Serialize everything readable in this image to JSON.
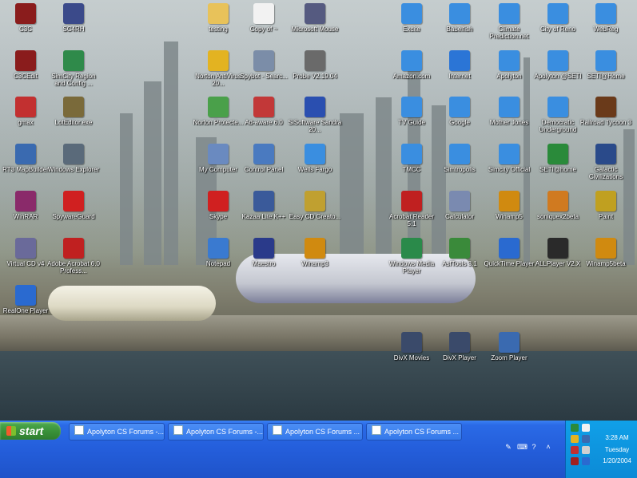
{
  "desktop": {
    "icons": [
      {
        "label": "C3C",
        "icon": "c3c-icon",
        "color": "#8a1c1c"
      },
      {
        "label": "SC4RH",
        "icon": "simcity4-icon",
        "color": "#3b4a8a"
      },
      {
        "label": "testing",
        "icon": "folder-icon",
        "color": "#e8c25a"
      },
      {
        "label": "Copy of ~",
        "icon": "document-icon",
        "color": "#f2f2f2"
      },
      {
        "label": "Microsoft Mouse",
        "icon": "mouse-icon",
        "color": "#555a80"
      },
      {
        "label": "Excite",
        "icon": "internet-shortcut-icon",
        "color": "#3a8ee0"
      },
      {
        "label": "Babelfish",
        "icon": "internet-shortcut-icon",
        "color": "#3a8ee0"
      },
      {
        "label": "Climate Prediction.net",
        "icon": "internet-shortcut-icon",
        "color": "#3a8ee0"
      },
      {
        "label": "City of Reno",
        "icon": "internet-shortcut-icon",
        "color": "#3a8ee0"
      },
      {
        "label": "WebReg",
        "icon": "internet-shortcut-icon",
        "color": "#3a8ee0"
      },
      {
        "label": "C3CEdit",
        "icon": "c3c-edit-icon",
        "color": "#8a1c1c"
      },
      {
        "label": "SimCity Region and Config ...",
        "icon": "simcity-region-icon",
        "color": "#2f8a4a"
      },
      {
        "label": "Norton AntiVirus 20...",
        "icon": "norton-antivirus-icon",
        "color": "#e3b321"
      },
      {
        "label": "Spybot - Searc...",
        "icon": "spybot-icon",
        "color": "#7b8da8"
      },
      {
        "label": "Probe V2.19.04",
        "icon": "probe-icon",
        "color": "#6a6a6a"
      },
      {
        "label": "Amazon.com",
        "icon": "internet-shortcut-icon",
        "color": "#3a8ee0"
      },
      {
        "label": "Internet",
        "icon": "internet-explorer-icon",
        "color": "#2b75d6"
      },
      {
        "label": "Apolyton",
        "icon": "internet-shortcut-icon",
        "color": "#3a8ee0"
      },
      {
        "label": "Apolyton @SETI",
        "icon": "internet-shortcut-icon",
        "color": "#3a8ee0"
      },
      {
        "label": "SETI@Home",
        "icon": "internet-shortcut-icon",
        "color": "#3a8ee0"
      },
      {
        "label": "gmax",
        "icon": "gmax-icon",
        "color": "#c23030"
      },
      {
        "label": "LotEditor.exe",
        "icon": "lot-editor-icon",
        "color": "#7a6a3a"
      },
      {
        "label": "Norton Protecte...",
        "icon": "norton-protected-recycle-bin-icon",
        "color": "#4aa04a"
      },
      {
        "label": "Ad-aware 6.0",
        "icon": "ad-aware-icon",
        "color": "#c23838"
      },
      {
        "label": "SiSoftware Sandra 20...",
        "icon": "sandra-icon",
        "color": "#2a4fb0"
      },
      {
        "label": "TV Guide",
        "icon": "internet-shortcut-icon",
        "color": "#3a8ee0"
      },
      {
        "label": "Google",
        "icon": "internet-shortcut-icon",
        "color": "#3a8ee0"
      },
      {
        "label": "Mother Jones",
        "icon": "internet-shortcut-icon",
        "color": "#3a8ee0"
      },
      {
        "label": "Democratic Underground",
        "icon": "internet-shortcut-icon",
        "color": "#3a8ee0"
      },
      {
        "label": "Railroad Tycoon 3",
        "icon": "railroad-tycoon-icon",
        "color": "#6a3a1a"
      },
      {
        "label": "RT3 MapBuilder",
        "icon": "globe-icon",
        "color": "#3a6ab0"
      },
      {
        "label": "Windows Explorer",
        "icon": "windows-explorer-icon",
        "color": "#5a6a7a"
      },
      {
        "label": "My Computer",
        "icon": "my-computer-icon",
        "color": "#6a8ac0"
      },
      {
        "label": "Control Panel",
        "icon": "control-panel-icon",
        "color": "#4a7ac0"
      },
      {
        "label": "Wells Fargo",
        "icon": "internet-shortcut-icon",
        "color": "#3a8ee0"
      },
      {
        "label": "TMCC",
        "icon": "internet-shortcut-icon",
        "color": "#3a8ee0"
      },
      {
        "label": "Simtropolis",
        "icon": "internet-shortcut-icon",
        "color": "#3a8ee0"
      },
      {
        "label": "Simcity Official",
        "icon": "internet-shortcut-icon",
        "color": "#3a8ee0"
      },
      {
        "label": "SETI@home",
        "icon": "seti-at-home-icon",
        "color": "#2a8a3a"
      },
      {
        "label": "Galactic Civilizations",
        "icon": "galactic-civilizations-icon",
        "color": "#2a4a8a"
      },
      {
        "label": "WinRAR",
        "icon": "winrar-icon",
        "color": "#8a2a6a"
      },
      {
        "label": "SpywareGuard",
        "icon": "spywareguard-icon",
        "color": "#d02020"
      },
      {
        "label": "Skype",
        "icon": "skype-icon",
        "color": "#d02020"
      },
      {
        "label": "Kazaa Lite K++",
        "icon": "kazaa-icon",
        "color": "#3a5a9a"
      },
      {
        "label": "Easy CD Creato...",
        "icon": "easy-cd-creator-icon",
        "color": "#c0a030"
      },
      {
        "label": "Acrobat Reader 5.1",
        "icon": "acrobat-reader-icon",
        "color": "#c02020"
      },
      {
        "label": "Calculator",
        "icon": "calculator-icon",
        "color": "#7a8ab0"
      },
      {
        "label": "Winamp5",
        "icon": "winamp-icon",
        "color": "#d08a10"
      },
      {
        "label": "soniquex2beta",
        "icon": "sonique-icon",
        "color": "#d07a20"
      },
      {
        "label": "Paint",
        "icon": "paint-icon",
        "color": "#c0a020"
      },
      {
        "label": "Virtual CD v4",
        "icon": "virtual-cd-icon",
        "color": "#6a6a9a"
      },
      {
        "label": "Adobe Acrobat 6.0 Profess...",
        "icon": "adobe-acrobat-icon",
        "color": "#c02020"
      },
      {
        "label": "Notepad",
        "icon": "notepad-icon",
        "color": "#3a7ad0"
      },
      {
        "label": "Maestro",
        "icon": "maestro-icon",
        "color": "#2a3a8a"
      },
      {
        "label": "Winamp3",
        "icon": "winamp-icon",
        "color": "#d08a10"
      },
      {
        "label": "Windows Media Player",
        "icon": "windows-media-player-icon",
        "color": "#2a8a4a"
      },
      {
        "label": "AsfTools 3.1",
        "icon": "asftools-icon",
        "color": "#3a8a3a"
      },
      {
        "label": "QuickTime Player",
        "icon": "quicktime-icon",
        "color": "#2a6ad0"
      },
      {
        "label": "ALLPlayer V2.X",
        "icon": "allplayer-icon",
        "color": "#2a2a2a"
      },
      {
        "label": "Winamp5beta",
        "icon": "winamp-icon",
        "color": "#d08a10"
      },
      {
        "label": "RealOne Player",
        "icon": "realone-player-icon",
        "color": "#2a6ad0"
      },
      {
        "label": "DivX Movies",
        "icon": "divx-icon",
        "color": "#3a4a6a"
      },
      {
        "label": "DivX Player",
        "icon": "divx-player-icon",
        "color": "#3a4a6a"
      },
      {
        "label": "Zoom Player",
        "icon": "zoom-player-icon",
        "color": "#3a6ab0"
      }
    ]
  },
  "taskbar": {
    "start_label": "start",
    "tasks": [
      {
        "label": "Apolyton CS Forums -..."
      },
      {
        "label": "Apolyton CS Forums -..."
      },
      {
        "label": "Apolyton CS Forums ..."
      },
      {
        "label": "Apolyton CS Forums ..."
      }
    ],
    "clock": {
      "time": "3:28 AM",
      "day": "Tuesday",
      "date": "1/20/2004"
    }
  }
}
